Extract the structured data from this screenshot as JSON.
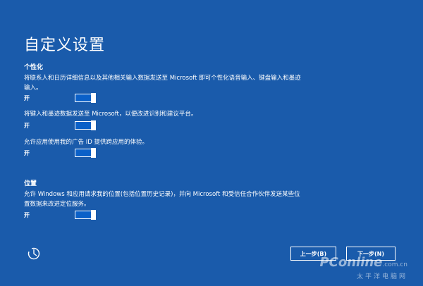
{
  "page_title": "自定义设置",
  "personalization": {
    "heading": "个性化",
    "settings": [
      {
        "description": "将联系人和日历详细信息以及其他相关输入数据发送至 Microsoft 即可个性化语音输入、键盘输入和墨迹输入。",
        "toggle_label": "开",
        "on": true
      },
      {
        "description": "将键入和墨迹数据发送至 Microsoft，以便改进识别和建议平台。",
        "toggle_label": "开",
        "on": true
      },
      {
        "description": "允许应用使用我的广告 ID 提供跨应用的体验。",
        "toggle_label": "开",
        "on": true
      }
    ]
  },
  "location": {
    "heading": "位置",
    "settings": [
      {
        "description": "允许 Windows 和应用请求我的位置(包括位置历史记录)，并向 Microsoft 和受信任合作伙伴发送某些位置数据来改进定位服务。",
        "toggle_label": "开",
        "on": true
      }
    ]
  },
  "footer": {
    "ease_of_access_icon": "ease-of-access-icon",
    "back_label": "上一步(B)",
    "next_label": "下一步(N)"
  },
  "watermark": {
    "logo": "PConline",
    "logo_suffix": ".com.cn",
    "subtitle": "太平洋电脑网"
  },
  "colors": {
    "background": "#1a5bab",
    "toggle_fill": "#0a60c8",
    "text": "#ffffff"
  }
}
